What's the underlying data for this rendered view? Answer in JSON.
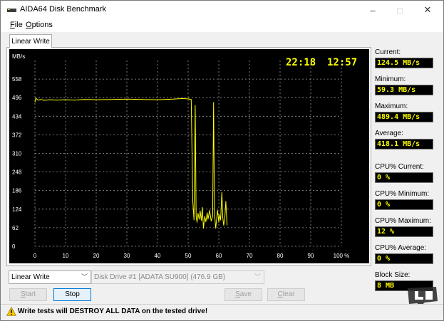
{
  "window": {
    "title": "AIDA64 Disk Benchmark",
    "minimize": "–",
    "maximize": "□",
    "close": "✕"
  },
  "menu": {
    "file": {
      "acc": "F",
      "rest": "ile"
    },
    "options": {
      "acc": "O",
      "rest": "ptions"
    }
  },
  "tab": {
    "label": "Linear Write"
  },
  "chart_data": {
    "type": "line",
    "ylabel": "MB/s",
    "y_ticks": [
      "558",
      "496",
      "434",
      "372",
      "310",
      "248",
      "186",
      "124",
      "62",
      "0"
    ],
    "x_ticks": [
      "0",
      "10",
      "20",
      "30",
      "40",
      "50",
      "60",
      "70",
      "80",
      "90",
      "100 %"
    ],
    "ylim": [
      0,
      620
    ],
    "xlim": [
      0,
      100
    ],
    "grid": true,
    "line_color": "#ffff00",
    "time_elapsed": "22:18",
    "time_remaining": "12:57",
    "series": [
      {
        "x": [
          0,
          0.3,
          1,
          2,
          3,
          5,
          7,
          10,
          13,
          16,
          20,
          25,
          30,
          35,
          40,
          45,
          48,
          50,
          51,
          51.5,
          51.9,
          52.3,
          52.6,
          52.9,
          53.2,
          53.6,
          53.9,
          54.3,
          54.6,
          55,
          55.4,
          55.8,
          56.2,
          56.5,
          57,
          57.5,
          58,
          58.3,
          58.6,
          59,
          59.3,
          59.6,
          60,
          60.3,
          60.6,
          61,
          61.3,
          61.6,
          62,
          62.3,
          62.7
        ],
        "y": [
          480,
          494,
          488,
          490,
          487,
          489,
          488,
          489,
          488,
          490,
          489,
          490,
          491,
          490,
          489,
          491,
          493,
          492,
          490,
          150,
          88,
          470,
          100,
          80,
          110,
          90,
          118,
          86,
          130,
          60,
          100,
          82,
          112,
          90,
          120,
          84,
          100,
          480,
          110,
          60,
          90,
          120,
          80,
          105,
          88,
          180,
          95,
          70,
          100,
          150,
          70
        ]
      }
    ]
  },
  "stats": {
    "current_label": "Current:",
    "current_value": "124.5 MB/s",
    "minimum_label": "Minimum:",
    "minimum_value": "59.3 MB/s",
    "maximum_label": "Maximum:",
    "maximum_value": "489.4 MB/s",
    "average_label": "Average:",
    "average_value": "418.1 MB/s",
    "cpu_current_label": "CPU% Current:",
    "cpu_current_value": "0 %",
    "cpu_minimum_label": "CPU% Minimum:",
    "cpu_minimum_value": "0 %",
    "cpu_maximum_label": "CPU% Maximum:",
    "cpu_maximum_value": "12 %",
    "cpu_average_label": "CPU% Average:",
    "cpu_average_value": "0 %",
    "block_size_label": "Block Size:",
    "block_size_value": "8 MB"
  },
  "controls": {
    "test_mode": "Linear Write",
    "drive": "Disk Drive #1  [ADATA SU900]  (476.9 GB)",
    "start": {
      "acc": "S",
      "rest": "tart"
    },
    "stop": "Stop",
    "save": {
      "acc": "S",
      "rest": "ave"
    },
    "clear": {
      "acc": "C",
      "rest": "lear"
    }
  },
  "status": {
    "warning": "Write tests will DESTROY ALL DATA on the tested drive!"
  },
  "colors": {
    "chart_bg": "#000000",
    "trace": "#ffff00",
    "value_text": "#ffff00",
    "grid": "#9a9a9a"
  },
  "icons": {
    "app": "disk-drive-icon",
    "warning": "warning-triangle-icon"
  }
}
